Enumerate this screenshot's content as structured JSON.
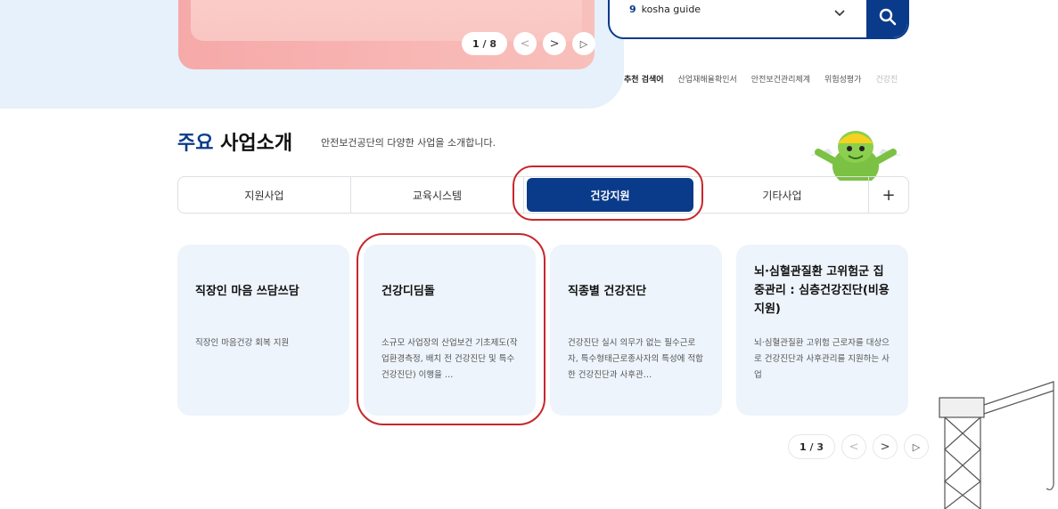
{
  "banner": {
    "pager": {
      "current": "1",
      "sep": "/",
      "total": "8",
      "prev": "<",
      "next": ">",
      "play": "▷"
    }
  },
  "search": {
    "query_icon": "9",
    "query": "kosha guide",
    "dropdown_icon": "chevron-down-icon",
    "button_icon": "search-icon",
    "recommend_label": "추천 검색어",
    "recommended": [
      "산업재해율확인서",
      "안전보건관리체계",
      "위험성평가",
      "건강진"
    ]
  },
  "section": {
    "title_accent": "주요",
    "title_rest": "사업소개",
    "subtitle": "안전보건공단의 다양한 사업을 소개합니다."
  },
  "tabs": [
    {
      "label": "지원사업",
      "active": false
    },
    {
      "label": "교육시스템",
      "active": false
    },
    {
      "label": "건강지원",
      "active": true
    },
    {
      "label": "기타사업",
      "active": false
    }
  ],
  "more_tab": "+",
  "cards": [
    {
      "title": "직장인 마음 쓰담쓰담",
      "desc": "직장인 마음건강 회복 지원"
    },
    {
      "title": "건강디딤돌",
      "desc": "소규모 사업장의 산업보건 기초제도(작업환경측정, 배치 전 건강진단 및 특수건강진단) 이행을 …"
    },
    {
      "title": "직종별 건강진단",
      "desc": "건강진단 실시 의무가 없는 필수근로자, 특수형태근로종사자의 특성에 적합한 건강진단과 사후관…"
    },
    {
      "title": "뇌·심혈관질환 고위험군 집중관리 : 심층건강진단(비용지원)",
      "desc": "뇌·심혈관질환 고위험 근로자를 대상으로 건강진단과 사후관리를 지원하는 사업"
    }
  ],
  "cards_pager": {
    "current": "1",
    "sep": "/",
    "total": "3",
    "prev": "<",
    "next": ">",
    "play": "▷"
  },
  "colors": {
    "primary": "#0a3a8a",
    "highlight": "#c8262b",
    "card_bg": "#eef4fb"
  }
}
